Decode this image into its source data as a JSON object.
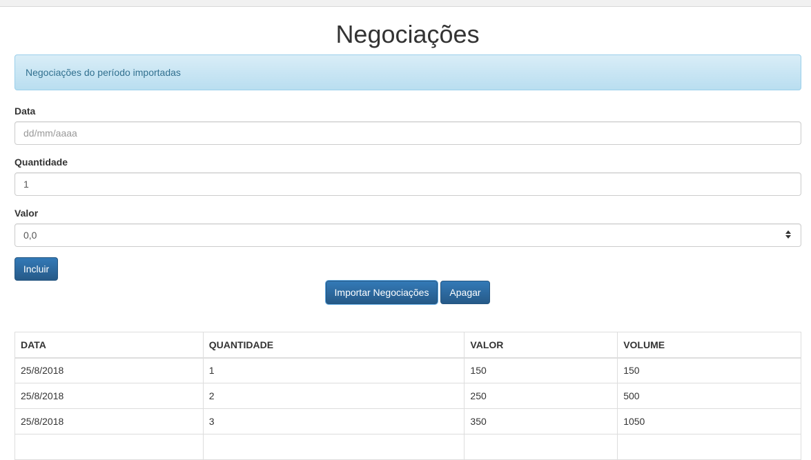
{
  "page": {
    "title": "Negociações"
  },
  "alert": {
    "message": "Negociações do período importadas"
  },
  "form": {
    "data_label": "Data",
    "data_placeholder": "dd/mm/aaaa",
    "quantidade_label": "Quantidade",
    "quantidade_value": "1",
    "valor_label": "Valor",
    "valor_value": "0,0",
    "submit_label": "Incluir"
  },
  "actions": {
    "import_label": "Importar Negociações",
    "clear_label": "Apagar"
  },
  "table": {
    "headers": [
      "DATA",
      "QUANTIDADE",
      "VALOR",
      "VOLUME"
    ],
    "rows": [
      [
        "25/8/2018",
        "1",
        "150",
        "150"
      ],
      [
        "25/8/2018",
        "2",
        "250",
        "500"
      ],
      [
        "25/8/2018",
        "3",
        "350",
        "1050"
      ]
    ]
  },
  "colors": {
    "primary": "#337ab7",
    "alert_bg": "#d9edf7",
    "alert_text": "#31708f"
  }
}
